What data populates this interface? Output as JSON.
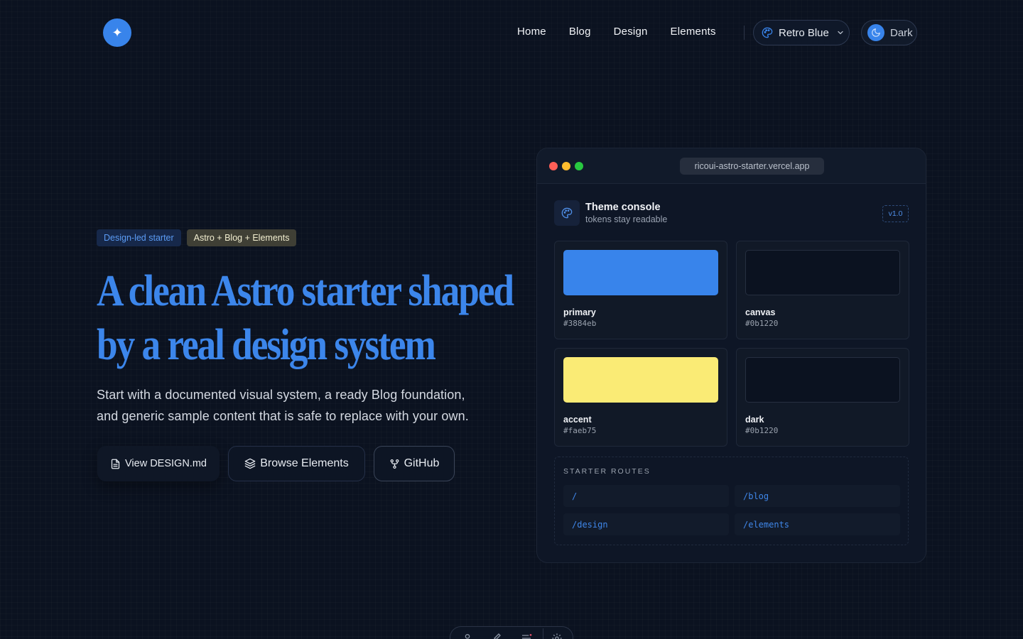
{
  "header": {
    "logo_glyph": "✦",
    "nav": [
      "Home",
      "Blog",
      "Design",
      "Elements"
    ],
    "theme_select": {
      "selected": "Retro Blue"
    },
    "mode_toggle": {
      "label": "Dark"
    }
  },
  "hero": {
    "badges": [
      "Design-led starter",
      "Astro + Blog + Elements"
    ],
    "title_line1": "A clean Astro starter shaped",
    "title_line2": "by a real design system",
    "subtitle_line1": "Start with a documented visual system, a ready Blog foundation,",
    "subtitle_line2": "and generic sample content that is safe to replace with your own.",
    "buttons": {
      "design": "View DESIGN.md",
      "elements": "Browse Elements",
      "github": "GitHub"
    }
  },
  "console": {
    "url": "ricoui-astro-starter.vercel.app",
    "title": "Theme console",
    "subtitle": "tokens stay readable",
    "version": "v1.0",
    "swatches": [
      {
        "name": "primary",
        "hex": "#3884eb",
        "color": "#3884eb"
      },
      {
        "name": "canvas",
        "hex": "#0b1220",
        "color": "#0b1220"
      },
      {
        "name": "accent",
        "hex": "#faeb75",
        "color": "#faeb75"
      },
      {
        "name": "dark",
        "hex": "#0b1220",
        "color": "#0b1220"
      }
    ],
    "routes_label": "STARTER ROUTES",
    "routes": [
      "/",
      "/blog",
      "/design",
      "/elements"
    ]
  },
  "colors": {
    "canvas": "#0b1220",
    "primary": "#3884eb",
    "accent": "#faeb75",
    "traffic_red": "#ff5f57",
    "traffic_yellow": "#febc2e",
    "traffic_green": "#28c840"
  }
}
